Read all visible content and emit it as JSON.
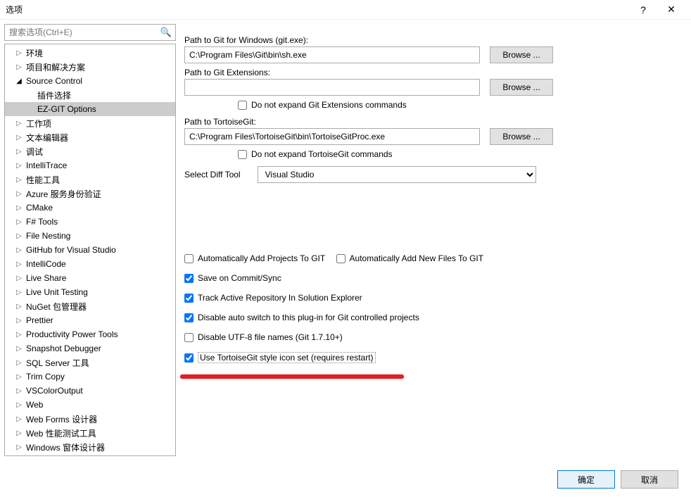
{
  "window": {
    "title": "选项",
    "help": "?",
    "close": "✕"
  },
  "search": {
    "placeholder": "搜索选项(Ctrl+E)"
  },
  "tree": [
    {
      "label": "环境",
      "depth": 1,
      "arrow": "▷"
    },
    {
      "label": "项目和解决方案",
      "depth": 1,
      "arrow": "▷"
    },
    {
      "label": "Source Control",
      "depth": 1,
      "arrow": "◢",
      "expanded": true
    },
    {
      "label": "插件选择",
      "depth": 2,
      "noarrow": true
    },
    {
      "label": "EZ-GIT Options",
      "depth": 2,
      "noarrow": true,
      "selected": true
    },
    {
      "label": "工作项",
      "depth": 1,
      "arrow": "▷"
    },
    {
      "label": "文本编辑器",
      "depth": 1,
      "arrow": "▷"
    },
    {
      "label": "调试",
      "depth": 1,
      "arrow": "▷"
    },
    {
      "label": "IntelliTrace",
      "depth": 1,
      "arrow": "▷"
    },
    {
      "label": "性能工具",
      "depth": 1,
      "arrow": "▷"
    },
    {
      "label": "Azure 服务身份验证",
      "depth": 1,
      "arrow": "▷"
    },
    {
      "label": "CMake",
      "depth": 1,
      "arrow": "▷"
    },
    {
      "label": "F# Tools",
      "depth": 1,
      "arrow": "▷"
    },
    {
      "label": "File Nesting",
      "depth": 1,
      "arrow": "▷"
    },
    {
      "label": "GitHub for Visual Studio",
      "depth": 1,
      "arrow": "▷"
    },
    {
      "label": "IntelliCode",
      "depth": 1,
      "arrow": "▷"
    },
    {
      "label": "Live Share",
      "depth": 1,
      "arrow": "▷"
    },
    {
      "label": "Live Unit Testing",
      "depth": 1,
      "arrow": "▷"
    },
    {
      "label": "NuGet 包管理器",
      "depth": 1,
      "arrow": "▷"
    },
    {
      "label": "Prettier",
      "depth": 1,
      "arrow": "▷"
    },
    {
      "label": "Productivity Power Tools",
      "depth": 1,
      "arrow": "▷"
    },
    {
      "label": "Snapshot Debugger",
      "depth": 1,
      "arrow": "▷"
    },
    {
      "label": "SQL Server 工具",
      "depth": 1,
      "arrow": "▷"
    },
    {
      "label": "Trim Copy",
      "depth": 1,
      "arrow": "▷"
    },
    {
      "label": "VSColorOutput",
      "depth": 1,
      "arrow": "▷"
    },
    {
      "label": "Web",
      "depth": 1,
      "arrow": "▷"
    },
    {
      "label": "Web Forms 设计器",
      "depth": 1,
      "arrow": "▷"
    },
    {
      "label": "Web 性能测试工具",
      "depth": 1,
      "arrow": "▷"
    },
    {
      "label": "Windows 窗体设计器",
      "depth": 1,
      "arrow": "▷"
    }
  ],
  "paths": {
    "gitWin": {
      "label": "Path to Git for Windows (git.exe):",
      "value": "C:\\Program Files\\Git\\bin\\sh.exe",
      "browse": "Browse ..."
    },
    "gitExt": {
      "label": "Path to Git Extensions:",
      "value": "",
      "browse": "Browse ...",
      "no_expand": "Do not expand Git Extensions commands"
    },
    "tortoise": {
      "label": "Path to TortoiseGit:",
      "value": "C:\\Program Files\\TortoiseGit\\bin\\TortoiseGitProc.exe",
      "browse": "Browse ...",
      "no_expand": "Do not expand TortoiseGit commands"
    }
  },
  "diff": {
    "label": "Select Diff Tool",
    "value": "Visual Studio"
  },
  "checks": {
    "autoAddProjects": "Automatically Add Projects To GIT",
    "autoAddFiles": "Automatically Add New Files To GIT",
    "saveOnCommit": "Save on Commit/Sync",
    "trackRepo": "Track Active Repository In Solution Explorer",
    "disableAutoSwitch": "Disable auto switch to this plug-in for Git controlled projects",
    "disableUtf8": "Disable UTF-8 file names (Git 1.7.10+)",
    "tortoiseIcons": "Use TortoiseGit style icon set (requires restart)"
  },
  "footer": {
    "ok": "确定",
    "cancel": "取消"
  }
}
